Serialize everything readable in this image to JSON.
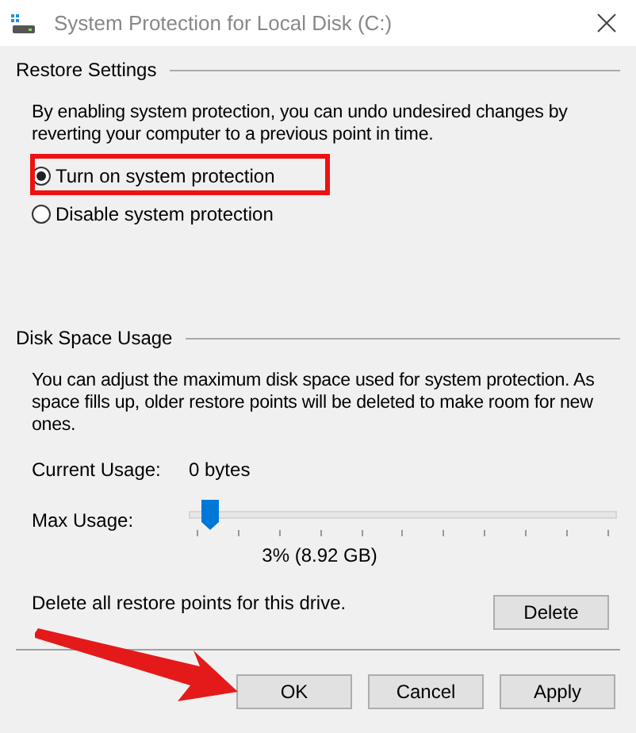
{
  "window": {
    "title": "System Protection for Local Disk (C:)"
  },
  "restore_settings": {
    "heading": "Restore Settings",
    "description": "By enabling system protection, you can undo undesired changes by reverting your computer to a previous point in time.",
    "options": [
      {
        "label": "Turn on system protection",
        "selected": true
      },
      {
        "label": "Disable system protection",
        "selected": false
      }
    ]
  },
  "disk_space_usage": {
    "heading": "Disk Space Usage",
    "description": "You can adjust the maximum disk space used for system protection. As space fills up, older restore points will be deleted to make room for new ones.",
    "current_usage_label": "Current Usage:",
    "current_usage_value": "0 bytes",
    "max_usage_label": "Max Usage:",
    "max_usage": {
      "level": 0.03
    },
    "max_usage_reading": "3% (8.92 GB)",
    "delete_text": "Delete all restore points for this drive.",
    "delete_button": "Delete"
  },
  "buttons": [
    "OK",
    "Cancel",
    "Apply"
  ]
}
